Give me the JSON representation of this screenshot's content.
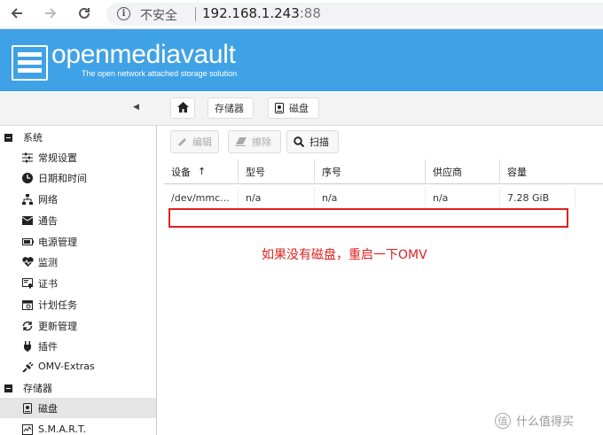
{
  "browser": {
    "security_label": "不安全",
    "url_host": "192.168.1.243",
    "url_port": ":88"
  },
  "header": {
    "app_name": "openmediavault",
    "tagline": "The open network attached storage solution"
  },
  "breadcrumb": {
    "storage": "存储器",
    "disks": "磁盘"
  },
  "sidebar": {
    "groups": [
      {
        "label": "系统"
      },
      {
        "label": "存储器"
      }
    ],
    "items": [
      {
        "label": "常规设置",
        "icon": "sliders-icon"
      },
      {
        "label": "日期和时间",
        "icon": "clock-icon"
      },
      {
        "label": "网络",
        "icon": "network-icon"
      },
      {
        "label": "通告",
        "icon": "envelope-icon"
      },
      {
        "label": "电源管理",
        "icon": "battery-icon"
      },
      {
        "label": "监测",
        "icon": "heartbeat-icon"
      },
      {
        "label": "证书",
        "icon": "certificate-icon"
      },
      {
        "label": "计划任务",
        "icon": "calendar-icon"
      },
      {
        "label": "更新管理",
        "icon": "refresh-icon"
      },
      {
        "label": "插件",
        "icon": "plugin-icon"
      },
      {
        "label": "OMV-Extras",
        "icon": "plug-icon"
      },
      {
        "label": "磁盘",
        "icon": "disk-icon"
      },
      {
        "label": "S.M.A.R.T.",
        "icon": "smart-icon"
      }
    ]
  },
  "actions": {
    "edit": "编辑",
    "wipe": "擦除",
    "scan": "扫描"
  },
  "grid": {
    "columns": [
      "设备",
      "型号",
      "序号",
      "供应商",
      "容量"
    ],
    "sort_indicator": "↑",
    "rows": [
      [
        "/dev/mmc...",
        "n/a",
        "n/a",
        "n/a",
        "7.28 GiB"
      ]
    ]
  },
  "annotation": "如果没有磁盘，重启一下OMV",
  "watermark": "值 什么值得买",
  "colors": {
    "header_bg": "#40a2e6",
    "annotation": "#e02020"
  }
}
